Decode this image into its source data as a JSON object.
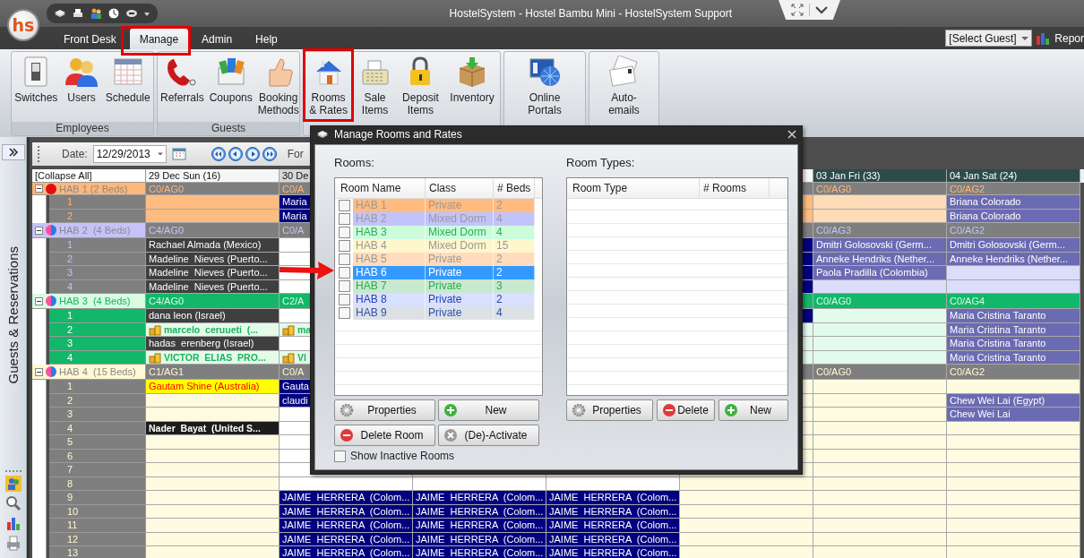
{
  "window": {
    "logo": "hs",
    "title": "HostelSystem - Hostel Bambu Mini - HostelSystem Support"
  },
  "menu_tabs": [
    {
      "label": "Front Desk",
      "selected": false,
      "highlighted": false
    },
    {
      "label": "Manage",
      "selected": true,
      "highlighted": true
    },
    {
      "label": "Admin",
      "selected": false,
      "highlighted": false
    },
    {
      "label": "Help",
      "selected": false,
      "highlighted": false
    }
  ],
  "guest_selector": {
    "value": "[Select Guest]"
  },
  "reports_button": {
    "label": "Repor"
  },
  "ribbon_groups": [
    {
      "label": "Employees",
      "buttons": [
        {
          "label": "Switches",
          "highlighted": false
        },
        {
          "label": "Users",
          "highlighted": false
        },
        {
          "label": "Schedule",
          "highlighted": false
        }
      ]
    },
    {
      "label": "Guests",
      "buttons": [
        {
          "label": "Referrals",
          "highlighted": false
        },
        {
          "label": "Coupons",
          "highlighted": false
        },
        {
          "label": "Booking\nMethods",
          "highlighted": false
        }
      ]
    },
    {
      "buttons": [
        {
          "label": "Rooms\n& Rates",
          "highlighted": true
        },
        {
          "label": "Sale\nItems",
          "highlighted": false
        },
        {
          "label": "Deposit\nItems",
          "highlighted": false
        },
        {
          "label": "Inventory",
          "highlighted": false
        }
      ]
    },
    {
      "buttons": [
        {
          "label": "Online\nPortals",
          "highlighted": false
        }
      ]
    },
    {
      "buttons": [
        {
          "label": "Auto-\nemails",
          "highlighted": false
        }
      ]
    }
  ],
  "sidebar": {
    "label": "Guests & Reservations"
  },
  "schedule": {
    "date_label": "Date:",
    "date": "12/29/2013",
    "format_label": "For",
    "collapse_all": "[Collapse All]",
    "day_headers": [
      {
        "label": "29 Dec Sun (16)",
        "kind": "light"
      },
      {
        "label": "30 De",
        "kind": "grey"
      },
      {
        "kind": "light"
      },
      {
        "label": "03 Jan Fri (33)",
        "kind": "dark"
      },
      {
        "label": "04 Jan Sat (24)",
        "kind": "dark"
      }
    ],
    "groups": [
      {
        "label": "HAB 1 (2 Beds)",
        "color": "#ffb77a",
        "kind": "private",
        "summary": [
          {
            "kind": "head",
            "text": "C0/AG0"
          },
          {
            "kind": "head",
            "text": "C0/A"
          },
          {
            "kind": "head"
          },
          {
            "kind": "head",
            "text": "C0/AG0"
          },
          {
            "kind": "head",
            "text": "C0/AG2"
          }
        ],
        "beds": [
          {
            "number": "1",
            "cells": [
              {
                "kind": "orange"
              },
              {
                "kind": "navy",
                "text": "Maria"
              },
              {
                "kind": "orange"
              },
              {
                "kind": "peach"
              },
              {
                "kind": "purple",
                "text": "Briana Colorado"
              }
            ]
          },
          {
            "number": "2",
            "cells": [
              {
                "kind": "orange"
              },
              {
                "kind": "navy",
                "text": "Maria"
              },
              {
                "kind": "orange"
              },
              {
                "kind": "peach"
              },
              {
                "kind": "purple",
                "text": "Briana Colorado"
              }
            ]
          }
        ]
      },
      {
        "label": "HAB 2  (4 Beds)",
        "color": "#c5c3f7",
        "kind": "mixed",
        "summary": [
          {
            "kind": "head",
            "text": "C4/AG0"
          },
          {
            "kind": "head",
            "text": "C0/A"
          },
          {
            "kind": "head"
          },
          {
            "kind": "head",
            "text": "C0/AG3"
          },
          {
            "kind": "head",
            "text": "C0/AG2"
          }
        ],
        "beds": [
          {
            "number": "1",
            "cells": [
              {
                "kind": "dark",
                "text": "Rachael Almada (Mexico)"
              },
              {
                "kind": "white"
              },
              {
                "kind": "navy"
              },
              {
                "kind": "purple",
                "text": "Dmitri Golosovski (Germ..."
              },
              {
                "kind": "purple",
                "text": "Dmitri Golosovski (Germ..."
              }
            ]
          },
          {
            "number": "2",
            "cells": [
              {
                "kind": "dark",
                "text": "Madeline  Nieves (Puerto..."
              },
              {
                "kind": "white"
              },
              {
                "kind": "navy"
              },
              {
                "kind": "purple",
                "text": "Anneke Hendriks (Nether..."
              },
              {
                "kind": "purple",
                "text": "Anneke Hendriks (Nether..."
              }
            ]
          },
          {
            "number": "3",
            "cells": [
              {
                "kind": "dark",
                "text": "Madeline  Nieves (Puerto..."
              },
              {
                "kind": "white"
              },
              {
                "kind": "navy"
              },
              {
                "kind": "purple",
                "text": "Paola Pradilla (Colombia)"
              },
              {
                "kind": "pale"
              }
            ]
          },
          {
            "number": "4",
            "cells": [
              {
                "kind": "dark",
                "text": "Madeline  Nieves (Puerto..."
              },
              {
                "kind": "white"
              },
              {
                "kind": "navy"
              },
              {
                "kind": "pale"
              },
              {
                "kind": "pale"
              }
            ]
          }
        ]
      },
      {
        "label": "HAB 3  (4 Beds)",
        "color": "#d8fbe2",
        "kind": "mixed",
        "summary": [
          {
            "kind": "green",
            "text": "C4/AG0"
          },
          {
            "kind": "green",
            "text": "C2/A"
          },
          {
            "kind": "green"
          },
          {
            "kind": "green",
            "text": "C0/AG0"
          },
          {
            "kind": "green",
            "text": "C0/AG4"
          }
        ],
        "beds": [
          {
            "number": "1",
            "cells": [
              {
                "kind": "dark",
                "text": "dana leon (Israel)"
              },
              {
                "kind": "white"
              },
              {
                "kind": "navy"
              },
              {
                "kind": "mint"
              },
              {
                "kind": "purple",
                "text": "Maria Cristina Taranto"
              }
            ]
          },
          {
            "number": "2",
            "cells": [
              {
                "kind": "vip",
                "text": "marcelo  ceruueti  (..."
              },
              {
                "kind": "vip",
                "text": "ma"
              },
              {
                "kind": "mint"
              },
              {
                "kind": "mint"
              },
              {
                "kind": "purple",
                "text": "Maria Cristina Taranto"
              }
            ]
          },
          {
            "number": "3",
            "cells": [
              {
                "kind": "dark",
                "text": "hadas  erenberg (Israel)"
              },
              {
                "kind": "white"
              },
              {
                "kind": "mint"
              },
              {
                "kind": "mint"
              },
              {
                "kind": "purple",
                "text": "Maria Cristina Taranto"
              }
            ]
          },
          {
            "number": "4",
            "cells": [
              {
                "kind": "vip",
                "text": "VICTOR  ELIAS  PRO..."
              },
              {
                "kind": "vip",
                "text": "VI"
              },
              {
                "kind": "mint"
              },
              {
                "kind": "mint"
              },
              {
                "kind": "purple",
                "text": "Maria Cristina Taranto"
              }
            ]
          }
        ]
      },
      {
        "label": "HAB 4  (15 Beds)",
        "color": "#fff8d2",
        "kind": "mixed",
        "summary": [
          {
            "kind": "head",
            "text": "C1/AG1"
          },
          {
            "kind": "head",
            "text": "C0/A"
          },
          {
            "kind": "head"
          },
          {
            "kind": "head",
            "text": "C0/AG0"
          },
          {
            "kind": "head",
            "text": "C0/AG2"
          }
        ],
        "beds": [
          {
            "number": "1",
            "cells": [
              {
                "kind": "alert",
                "text": "Gautam Shine (Australia)"
              },
              {
                "kind": "navy",
                "text": "Gauta"
              },
              {
                "kind": "cream"
              },
              {
                "kind": "cream"
              },
              {
                "kind": "cream"
              }
            ]
          },
          {
            "number": "2",
            "cells": [
              {
                "kind": "cream"
              },
              {
                "kind": "navy",
                "text": "claudi"
              },
              {
                "kind": "cream"
              },
              {
                "kind": "cream"
              },
              {
                "kind": "purple",
                "text": "Chew Wei Lai (Egypt)"
              }
            ]
          },
          {
            "number": "3",
            "cells": [
              {
                "kind": "cream"
              },
              {
                "kind": "white"
              },
              {
                "kind": "cream"
              },
              {
                "kind": "cream"
              },
              {
                "kind": "purple",
                "text": "Chew Wei Lai"
              }
            ]
          },
          {
            "number": "4",
            "cells": [
              {
                "kind": "black",
                "text": "Nader  Bayat  (United S..."
              },
              {
                "kind": "white"
              },
              {
                "kind": "cream"
              },
              {
                "kind": "cream"
              },
              {
                "kind": "cream"
              }
            ]
          },
          {
            "number": "5",
            "cells": [
              {
                "kind": "cream"
              },
              {
                "kind": "white"
              },
              {
                "kind": "cream"
              },
              {
                "kind": "cream"
              },
              {
                "kind": "cream"
              }
            ]
          },
          {
            "number": "6",
            "cells": [
              {
                "kind": "cream"
              },
              {
                "kind": "white"
              },
              {
                "kind": "cream"
              },
              {
                "kind": "cream"
              },
              {
                "kind": "cream"
              }
            ]
          },
          {
            "number": "7",
            "cells": [
              {
                "kind": "cream"
              },
              {
                "kind": "white"
              },
              {
                "kind": "cream"
              },
              {
                "kind": "cream"
              },
              {
                "kind": "cream"
              },
              {
                "kind": "cream"
              },
              {
                "kind": "cream"
              }
            ]
          },
          {
            "number": "8",
            "cells": [
              {
                "kind": "cream"
              },
              {
                "kind": "white"
              },
              {
                "kind": "white"
              },
              {
                "kind": "white"
              },
              {
                "kind": "cream"
              },
              {
                "kind": "cream"
              },
              {
                "kind": "cream"
              }
            ]
          },
          {
            "number": "9",
            "cells": [
              {
                "kind": "cream"
              },
              {
                "kind": "navy",
                "text": "JAIME  HERRERA  (Colom..."
              },
              {
                "kind": "navy",
                "text": "JAIME  HERRERA  (Colom..."
              },
              {
                "kind": "navy",
                "text": "JAIME  HERRERA  (Colom..."
              },
              {
                "kind": "cream"
              },
              {
                "kind": "cream"
              },
              {
                "kind": "cream"
              }
            ]
          },
          {
            "number": "10",
            "cells": [
              {
                "kind": "cream"
              },
              {
                "kind": "navy",
                "text": "JAIME  HERRERA  (Colom..."
              },
              {
                "kind": "navy",
                "text": "JAIME  HERRERA  (Colom..."
              },
              {
                "kind": "navy",
                "text": "JAIME  HERRERA  (Colom..."
              },
              {
                "kind": "cream"
              },
              {
                "kind": "cream"
              },
              {
                "kind": "cream"
              }
            ]
          },
          {
            "number": "11",
            "cells": [
              {
                "kind": "cream"
              },
              {
                "kind": "navy",
                "text": "JAIME  HERRERA  (Colom..."
              },
              {
                "kind": "navy",
                "text": "JAIME  HERRERA  (Colom..."
              },
              {
                "kind": "navy",
                "text": "JAIME  HERRERA  (Colom..."
              },
              {
                "kind": "cream"
              },
              {
                "kind": "cream"
              },
              {
                "kind": "cream"
              }
            ]
          },
          {
            "number": "12",
            "cells": [
              {
                "kind": "cream"
              },
              {
                "kind": "navy",
                "text": "JAIME  HERRERA  (Colom..."
              },
              {
                "kind": "navy",
                "text": "JAIME  HERRERA  (Colom..."
              },
              {
                "kind": "navy",
                "text": "JAIME  HERRERA  (Colom..."
              },
              {
                "kind": "cream"
              },
              {
                "kind": "cream"
              },
              {
                "kind": "cream"
              }
            ]
          },
          {
            "number": "13",
            "cells": [
              {
                "kind": "cream"
              },
              {
                "kind": "navy",
                "text": "JAIME  HERRERA  (Colom..."
              },
              {
                "kind": "navy",
                "text": "JAIME  HERRERA  (Colom..."
              },
              {
                "kind": "navy",
                "text": "JAIME  HERRERA  (Colom..."
              },
              {
                "kind": "cream"
              },
              {
                "kind": "cream"
              },
              {
                "kind": "cream"
              }
            ]
          }
        ]
      }
    ]
  },
  "dialog": {
    "title": "Manage Rooms and Rates",
    "rooms_label": "Rooms:",
    "rooms_columns": [
      "Room Name",
      "Class",
      "# Beds"
    ],
    "rooms": [
      {
        "name": "HAB 1",
        "class": "Private",
        "beds": "2",
        "color": "#ffbb80",
        "checked": false,
        "selected": false
      },
      {
        "name": "HAB 2",
        "class": "Mixed Dorm",
        "beds": "4",
        "color": "#c3c3fb",
        "checked": false,
        "selected": false
      },
      {
        "name": "HAB 3",
        "class": "Mixed Dorm",
        "beds": "4",
        "color": "#ccfcdc",
        "checked": false,
        "selected": false
      },
      {
        "name": "HAB 4",
        "class": "Mixed Dorm",
        "beds": "15",
        "color": "#fff6cc",
        "checked": false,
        "selected": false
      },
      {
        "name": "HAB 5",
        "class": "Private",
        "beds": "2",
        "color": "#ffdcbc",
        "checked": false,
        "selected": false
      },
      {
        "name": "HAB 6",
        "class": "Private",
        "beds": "2",
        "checked": false,
        "selected": true
      },
      {
        "name": "HAB 7",
        "class": "Private",
        "beds": "3",
        "color": "#c8e8d0",
        "checked": false,
        "selected": false
      },
      {
        "name": "HAB 8",
        "class": "Private",
        "beds": "2",
        "color": "#d8e0ff",
        "checked": false,
        "selected": false
      },
      {
        "name": "HAB 9",
        "class": "Private",
        "beds": "4",
        "color": "#dde0e6",
        "checked": false,
        "selected": false
      }
    ],
    "rooms_buttons": [
      {
        "label": "Properties",
        "kind": "properties"
      },
      {
        "label": "New",
        "kind": "new"
      },
      {
        "label": "Delete Room",
        "kind": "delete"
      },
      {
        "label": "(De)-Activate",
        "kind": "activate"
      }
    ],
    "show_inactive": {
      "label": "Show Inactive Rooms",
      "checked": false
    },
    "types_label": "Room Types:",
    "types_columns": [
      "Room Type",
      "# Rooms"
    ],
    "types_buttons": [
      {
        "label": "Properties",
        "kind": "properties"
      },
      {
        "label": "Delete",
        "kind": "delete"
      },
      {
        "label": "New",
        "kind": "new"
      }
    ]
  }
}
